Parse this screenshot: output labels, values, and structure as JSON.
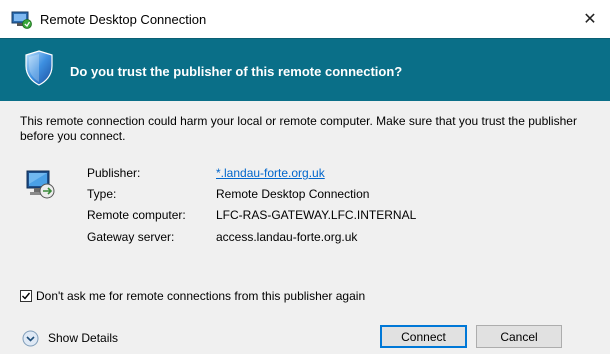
{
  "window": {
    "title": "Remote Desktop Connection",
    "close_glyph": "✕"
  },
  "banner": {
    "question": "Do you trust the publisher of this remote connection?",
    "icon": "shield-icon",
    "background": "#0a6f88"
  },
  "warning_text": "This remote connection could harm your local or remote computer. Make sure that you trust the publisher before you connect.",
  "details": {
    "icon": "remote-computer-icon",
    "rows": [
      {
        "label": "Publisher:",
        "value": "*.landau-forte.org.uk"
      },
      {
        "label": "Type:",
        "value": "Remote Desktop Connection"
      },
      {
        "label": "Remote computer:",
        "value": "LFC-RAS-GATEWAY.LFC.INTERNAL"
      },
      {
        "label": "Gateway server:",
        "value": "access.landau-forte.org.uk"
      }
    ]
  },
  "dont_ask": {
    "label": "Don't ask me for remote connections from this publisher again",
    "checked": true
  },
  "footer": {
    "show_details_label": "Show Details",
    "connect_label": "Connect",
    "cancel_label": "Cancel"
  },
  "colors": {
    "accent": "#0078d7",
    "link": "#0066cc"
  }
}
